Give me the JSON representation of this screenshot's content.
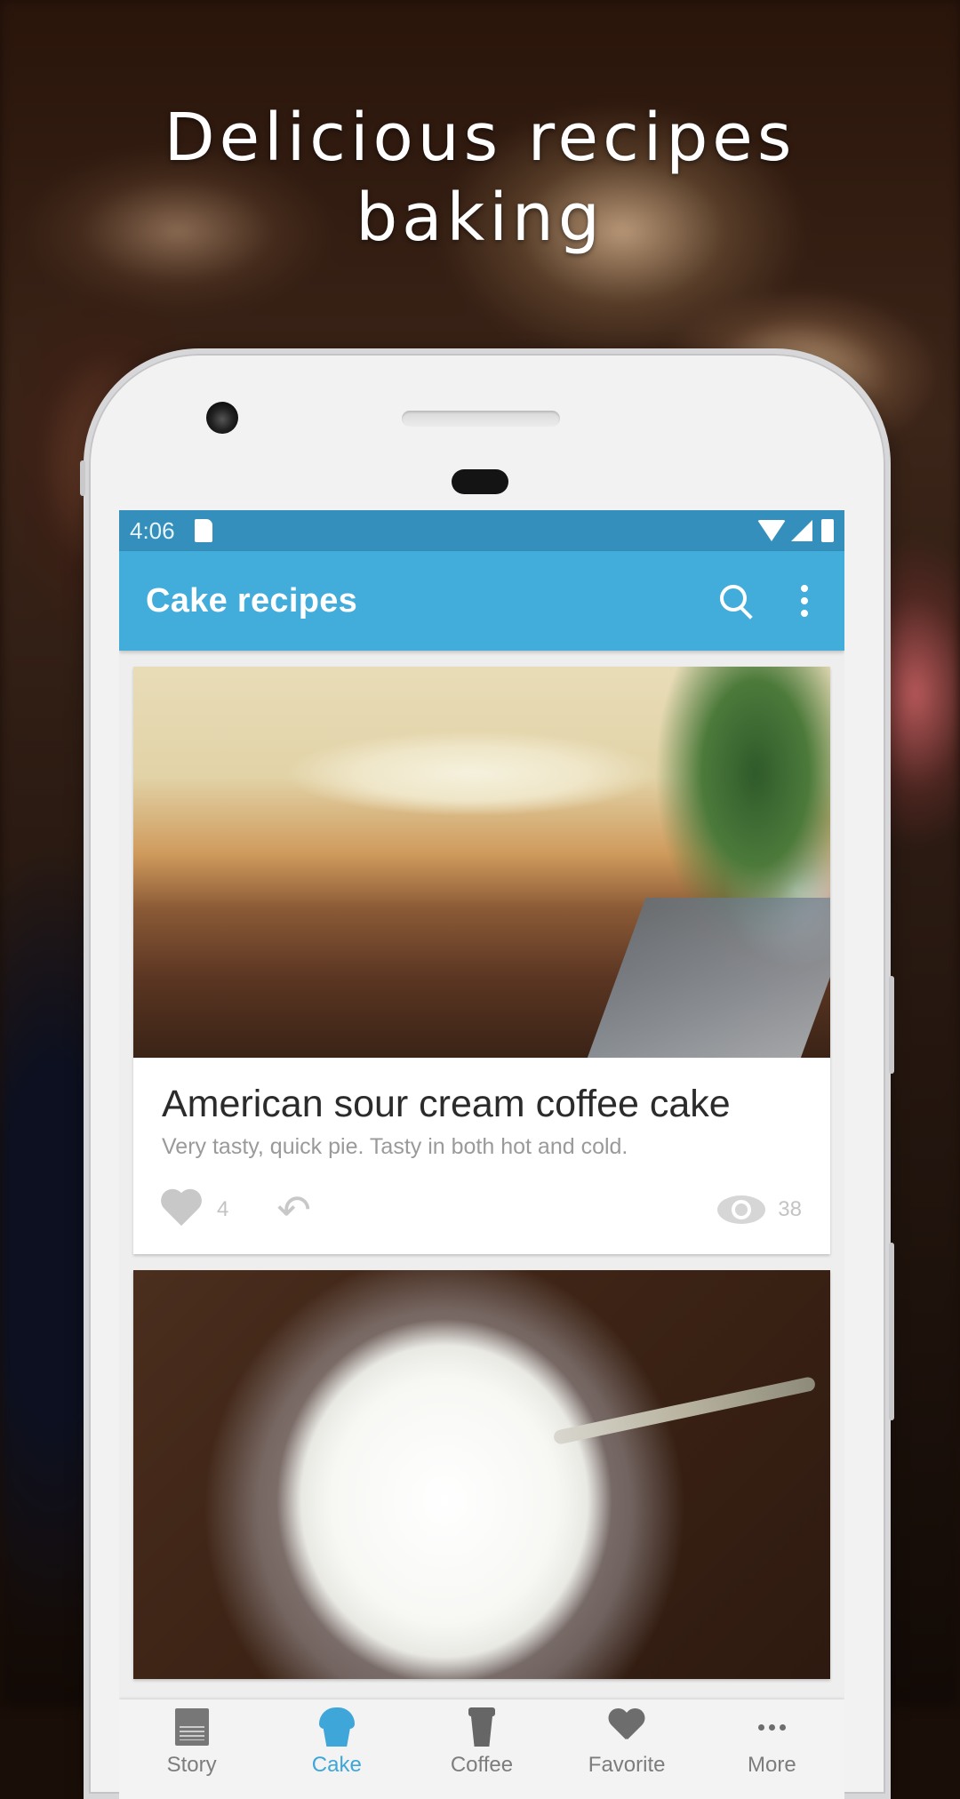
{
  "promo": {
    "headline_line1": "Delicious recipes",
    "headline_line2": "baking"
  },
  "status_bar": {
    "time": "4:06",
    "icons": [
      "sd-card-icon",
      "wifi-icon",
      "signal-icon",
      "battery-icon"
    ]
  },
  "app_bar": {
    "title": "Cake recipes",
    "actions": [
      "search-icon",
      "more-vert-icon"
    ],
    "color": "#42acdb",
    "status_color": "#348fbc"
  },
  "cards": [
    {
      "image": "cheesecake-photo",
      "title": "American sour cream coffee cake",
      "subtitle": "Very tasty, quick pie. Tasty in both hot and cold.",
      "likes": "4",
      "views": "38"
    },
    {
      "image": "sour-cream-bowl-photo"
    }
  ],
  "bottom_nav": {
    "active_color": "#3ea6d8",
    "items": [
      {
        "label": "Story",
        "icon": "newspaper-icon",
        "active": false
      },
      {
        "label": "Cake",
        "icon": "cupcake-icon",
        "active": true
      },
      {
        "label": "Coffee",
        "icon": "coffee-cup-icon",
        "active": false
      },
      {
        "label": "Favorite",
        "icon": "heart-icon",
        "active": false
      },
      {
        "label": "More",
        "icon": "more-horiz-icon",
        "active": false
      }
    ]
  }
}
